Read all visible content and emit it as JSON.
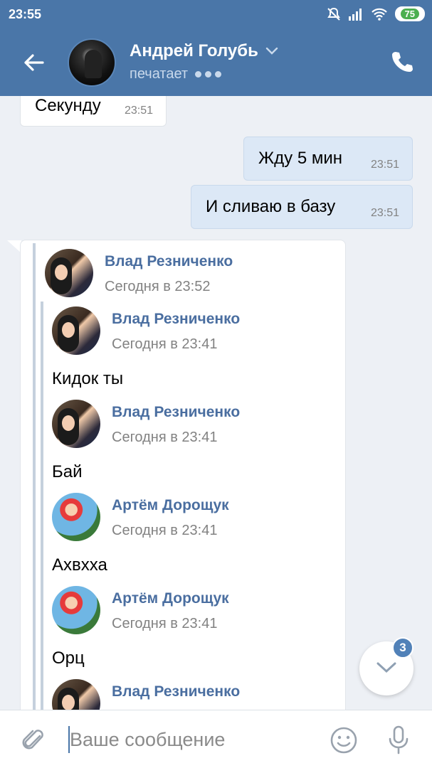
{
  "status_bar": {
    "time": "23:55",
    "battery": "75",
    "icons": [
      "bell-off-icon",
      "signal-icon",
      "wifi-icon",
      "battery-icon"
    ]
  },
  "header": {
    "name": "Андрей Голубь",
    "status": "печатает"
  },
  "messages": [
    {
      "direction": "in",
      "text": "Секунду",
      "time": "23:51"
    },
    {
      "direction": "out",
      "text": "Жду 5 мин",
      "time": "23:51"
    },
    {
      "direction": "out",
      "text": "И сливаю в базу",
      "time": "23:51"
    }
  ],
  "forwarded": {
    "outer": {
      "author": "Влад Резниченко",
      "date": "Сегодня в 23:52"
    },
    "items": [
      {
        "author": "Влад Резниченко",
        "date": "Сегодня в 23:41",
        "text": "Кидок ты"
      },
      {
        "author": "Влад Резниченко",
        "date": "Сегодня в 23:41",
        "text": "Бай"
      },
      {
        "author": "Артём Дорощук",
        "date": "Сегодня в 23:41",
        "text": "Ахвхха"
      },
      {
        "author": "Артём Дорощук",
        "date": "Сегодня в 23:41",
        "text": "Орц"
      },
      {
        "author": "Влад Резниченко"
      }
    ]
  },
  "scroll": {
    "unread_count": "3"
  },
  "composer": {
    "placeholder": "Ваше сообщение"
  },
  "colors": {
    "header": "#4a76a8",
    "outgoing_bubble": "#dce8f6",
    "author_link": "#4a6ea0",
    "background": "#edf0f5"
  }
}
